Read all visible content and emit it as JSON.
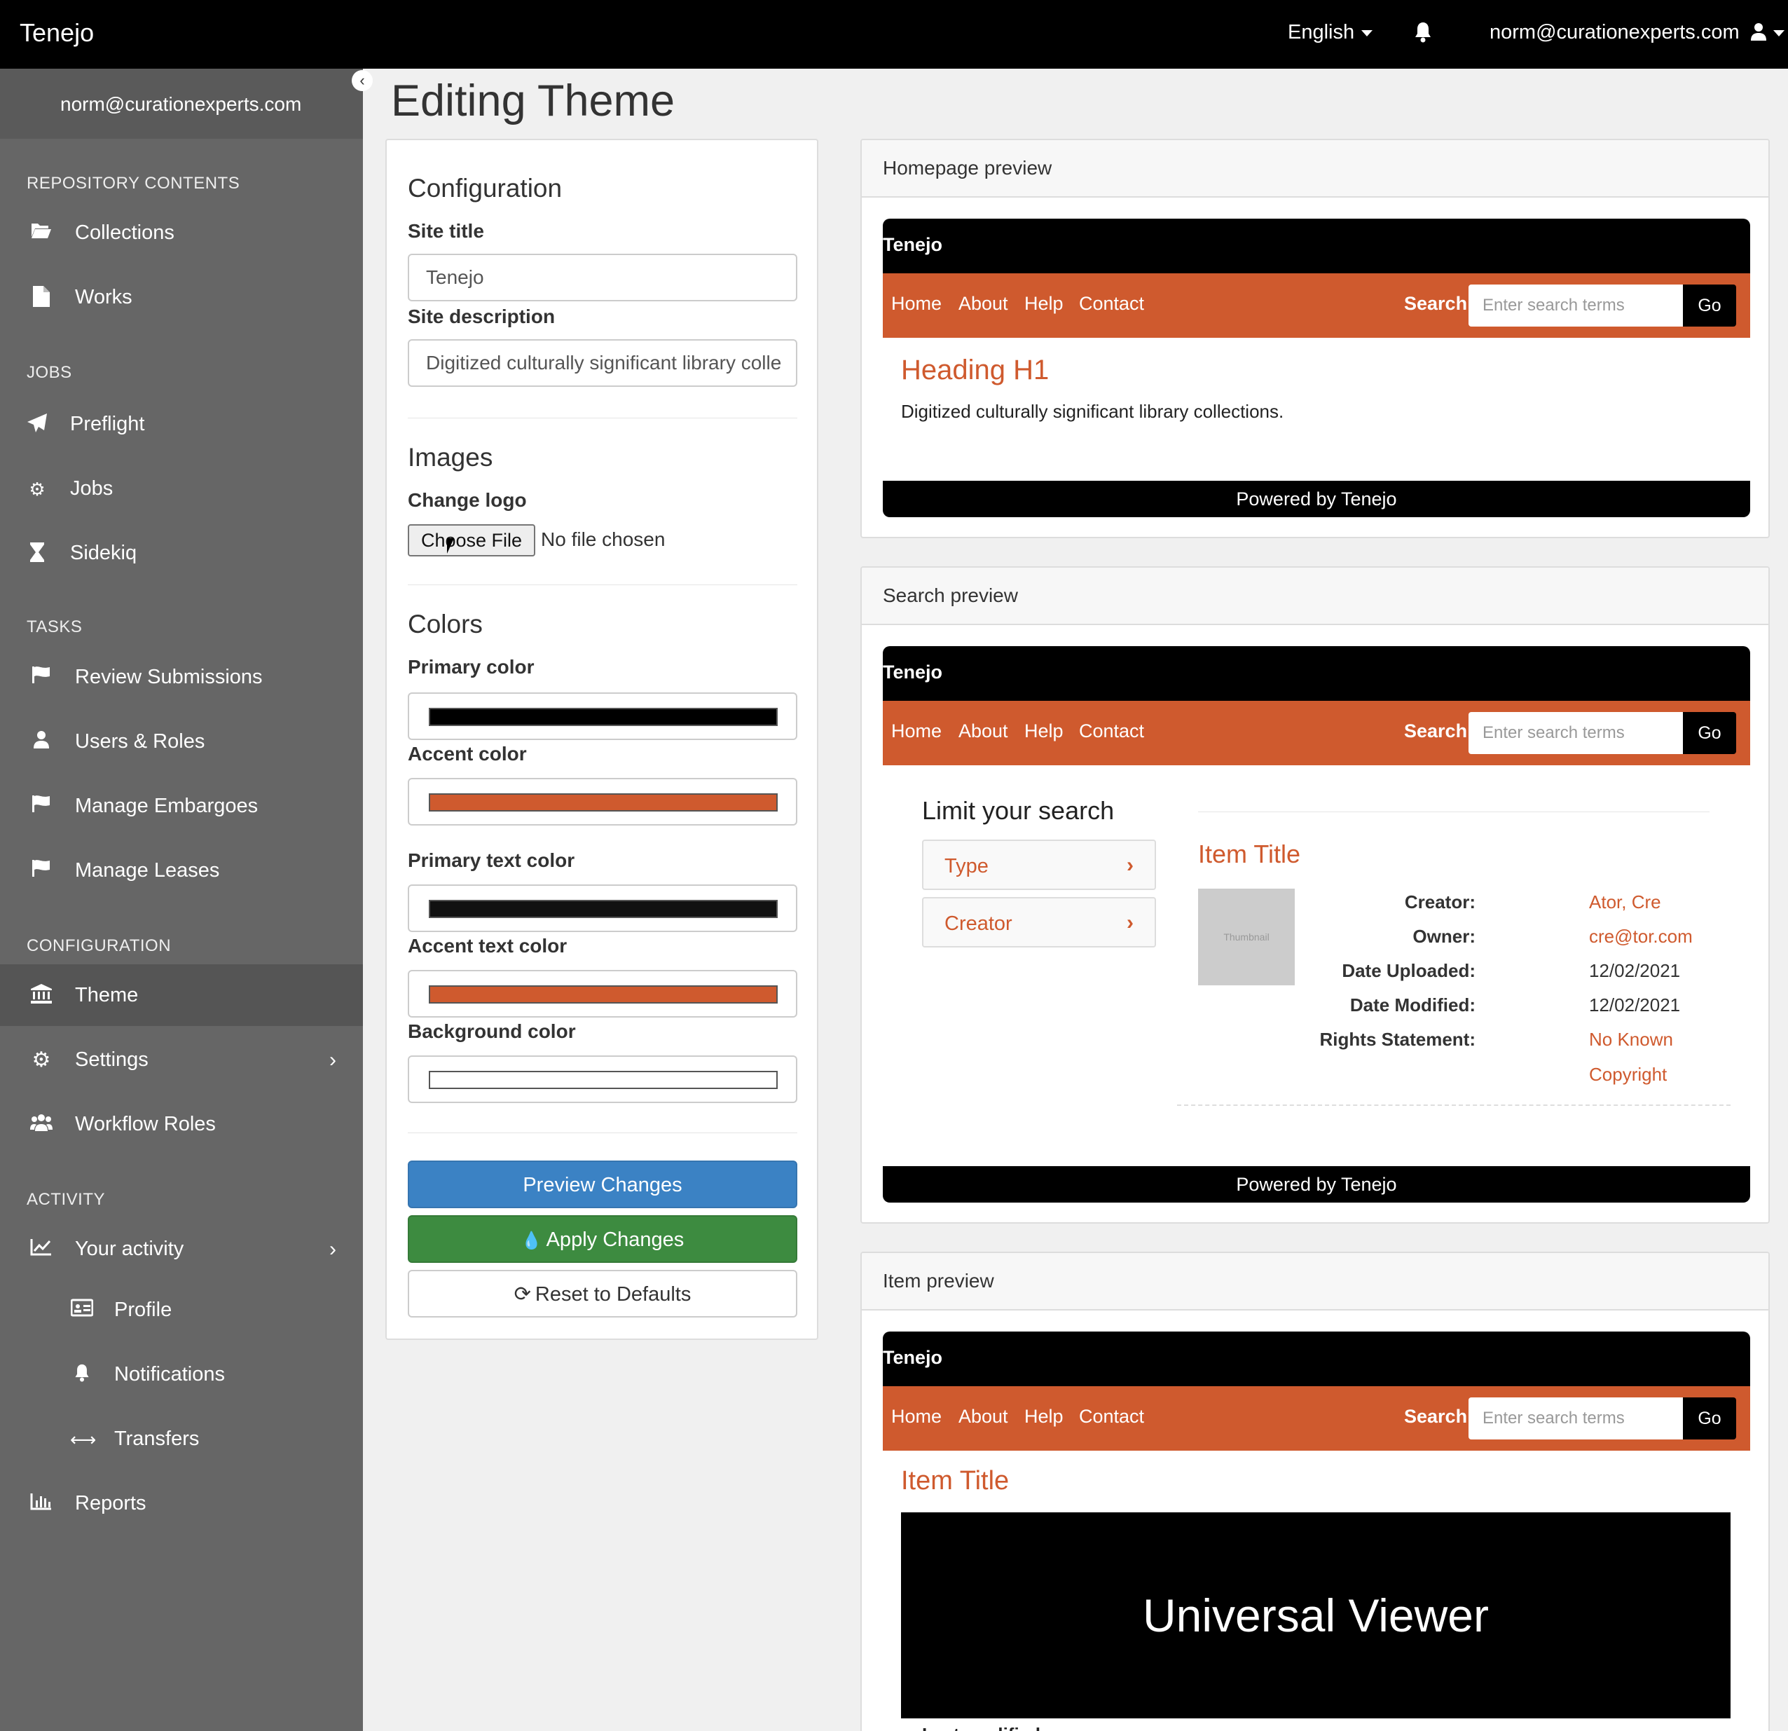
{
  "topbar": {
    "brand": "Tenejo",
    "language": "English",
    "user": "norm@curationexperts.com"
  },
  "sidebar": {
    "user_email": "norm@curationexperts.com",
    "sections": {
      "repository": "REPOSITORY CONTENTS",
      "jobs": "JOBS",
      "tasks": "TASKS",
      "configuration": "CONFIGURATION",
      "activity": "ACTIVITY"
    },
    "items": {
      "collections": "Collections",
      "works": "Works",
      "preflight": "Preflight",
      "jobs": "Jobs",
      "sidekiq": "Sidekiq",
      "review": "Review Submissions",
      "users": "Users & Roles",
      "embargoes": "Manage Embargoes",
      "leases": "Manage Leases",
      "theme": "Theme",
      "settings": "Settings",
      "workflow": "Workflow Roles",
      "activity": "Your activity",
      "profile": "Profile",
      "notifications": "Notifications",
      "transfers": "Transfers",
      "reports": "Reports"
    }
  },
  "page": {
    "title": "Editing Theme"
  },
  "config": {
    "configuration_title": "Configuration",
    "site_title_label": "Site title",
    "site_title_value": "Tenejo",
    "site_desc_label": "Site description",
    "site_desc_value": "Digitized culturally significant library colle",
    "images_title": "Images",
    "change_logo_label": "Change logo",
    "choose_file": "Choose File",
    "no_file": "No file chosen",
    "colors_title": "Colors",
    "primary_color_label": "Primary color",
    "accent_color_label": "Accent color",
    "primary_text_label": "Primary text color",
    "accent_text_label": "Accent text color",
    "background_label": "Background color",
    "colors": {
      "primary": "#000000",
      "accent": "#cf5a2e",
      "primary_text": "#111111",
      "accent_text": "#cf5a2e",
      "background": "#ffffff"
    },
    "preview_button": "Preview Changes",
    "apply_button": "Apply Changes",
    "reset_button": "Reset to Defaults"
  },
  "preview": {
    "brand": "Tenejo",
    "nav": {
      "home": "Home",
      "about": "About",
      "help": "Help",
      "contact": "Contact"
    },
    "search_label": "Search",
    "search_placeholder": "Enter search terms",
    "go": "Go",
    "footer": "Powered by Tenejo",
    "homepage": {
      "header": "Homepage preview",
      "heading": "Heading H1",
      "description": "Digitized culturally significant library collections."
    },
    "search": {
      "header": "Search preview",
      "limit_title": "Limit your search",
      "facet_type": "Type",
      "facet_creator": "Creator",
      "item_title": "Item Title",
      "thumbnail": "Thumbnail",
      "meta": {
        "creator_k": "Creator:",
        "creator_v": "Ator, Cre",
        "owner_k": "Owner:",
        "owner_v": "cre@tor.com",
        "uploaded_k": "Date Uploaded:",
        "uploaded_v": "12/02/2021",
        "modified_k": "Date Modified:",
        "modified_v": "12/02/2021",
        "rights_k": "Rights Statement:",
        "rights_v1": "No Known",
        "rights_v2": "Copyright"
      }
    },
    "item": {
      "header": "Item preview",
      "item_title": "Item Title",
      "viewer": "Universal Viewer",
      "last_modified": "Last modified"
    }
  }
}
